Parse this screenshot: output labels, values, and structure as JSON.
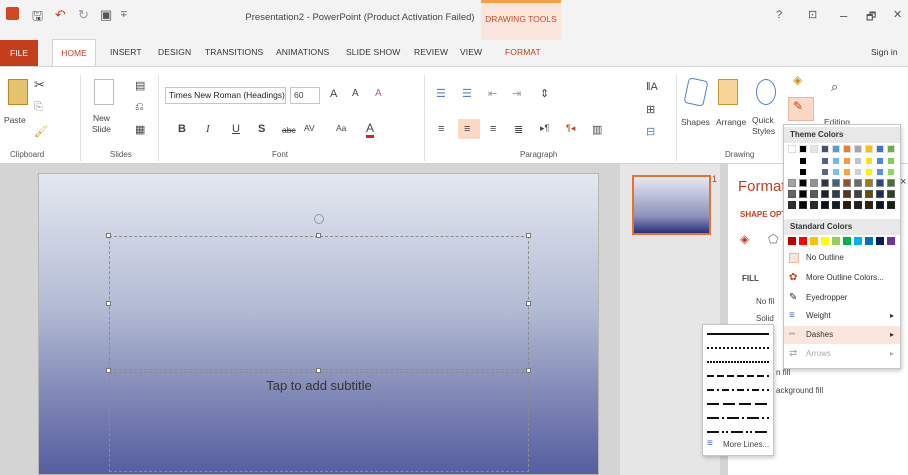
{
  "title": "Presentation2 - PowerPoint (Product Activation Failed)",
  "contextual_tab_group": "DRAWING TOOLS",
  "sign_in": "Sign in",
  "window_controls": {
    "help": "?",
    "restore_ribbon": "⊡",
    "minimize": "–",
    "maximize": "🗗",
    "close": "✕"
  },
  "tabs": [
    "FILE",
    "HOME",
    "INSERT",
    "DESIGN",
    "TRANSITIONS",
    "ANIMATIONS",
    "SLIDE SHOW",
    "REVIEW",
    "VIEW",
    "FORMAT"
  ],
  "ribbon": {
    "clipboard": {
      "label": "Clipboard",
      "paste": "Paste"
    },
    "slides": {
      "label": "Slides",
      "new_slide": "New\nSlide"
    },
    "font": {
      "label": "Font",
      "font_name": "Times New Roman (Headings)",
      "font_size": "60"
    },
    "paragraph": {
      "label": "Paragraph"
    },
    "drawing": {
      "label": "Drawing",
      "shapes": "Shapes",
      "arrange": "Arrange",
      "quick_styles": "Quick\nStyles"
    },
    "editing": {
      "label": "Editing"
    }
  },
  "slide": {
    "subtitle_placeholder": "Tap to add subtitle"
  },
  "thumbnail": {
    "number": "1"
  },
  "format_pane": {
    "title": "Format",
    "section": "SHAPE OPT",
    "fill_header": "FILL",
    "no_fill": "No fil",
    "solid": "Solid",
    "gradient_fill": "n fill",
    "background_fill": "ackground fill"
  },
  "outline_menu": {
    "theme_colors": "Theme Colors",
    "standard_colors": "Standard Colors",
    "no_outline": "No Outline",
    "more_outline_colors": "More Outline Colors...",
    "eyedropper": "Eyedropper",
    "weight": "Weight",
    "dashes": "Dashes",
    "arrows": "Arrows",
    "theme_top": [
      "#ffffff",
      "#000000",
      "#e7e6e6",
      "#44546a",
      "#5b9bd5",
      "#ed7d31",
      "#a5a5a5",
      "#ffc000",
      "#4472c4",
      "#70ad47"
    ],
    "standard": [
      "#c00000",
      "#ff0000",
      "#ffc000",
      "#ffff00",
      "#92d050",
      "#00b050",
      "#00b0f0",
      "#0070c0",
      "#002060",
      "#7030a0"
    ]
  },
  "dash_menu": {
    "more_lines": "More Lines..."
  }
}
